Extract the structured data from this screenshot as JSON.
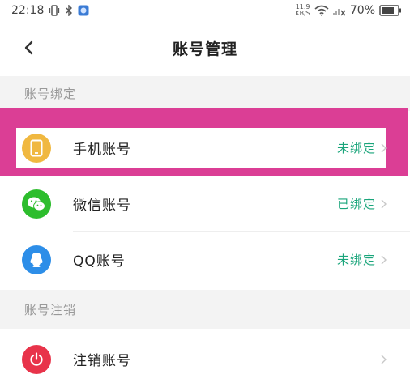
{
  "status_bar": {
    "time": "22:18",
    "speed_value": "11.9",
    "speed_unit": "KB/S",
    "battery": "70%"
  },
  "header": {
    "title": "账号管理",
    "back_icon": "chevron-left-icon"
  },
  "sections": {
    "binding": {
      "title": "账号绑定"
    },
    "cancel": {
      "title": "账号注销"
    }
  },
  "rows": [
    {
      "label": "手机账号",
      "status": "未绑定",
      "icon": "phone-icon",
      "icon_color": "#f0b840"
    },
    {
      "label": "微信账号",
      "status": "已绑定",
      "icon": "wechat-icon",
      "icon_color": "#2dbd2d"
    },
    {
      "label": "QQ账号",
      "status": "未绑定",
      "icon": "qq-icon",
      "icon_color": "#2d8ee8"
    },
    {
      "label": "注销账号",
      "status": "",
      "icon": "power-icon",
      "icon_color": "#e8334a"
    }
  ],
  "colors": {
    "status_green": "#1aa57b",
    "highlight": "#db3e95",
    "section_bg": "#f3f3f3"
  }
}
